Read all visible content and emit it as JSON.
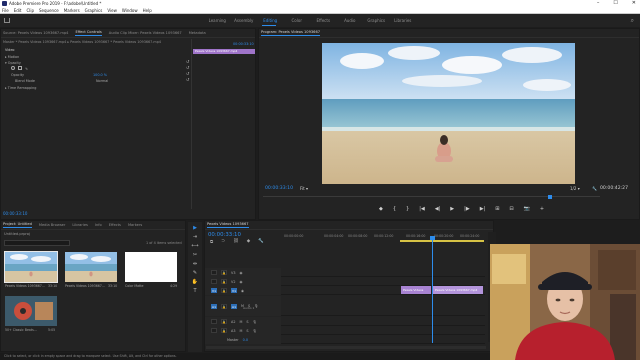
{
  "window": {
    "title": "Adobe Premiere Pro 2019 - F:\\adobe\\Untitled *",
    "minimize": "–",
    "maximize": "☐",
    "close": "✕"
  },
  "menu": [
    "File",
    "Edit",
    "Clip",
    "Sequence",
    "Markers",
    "Graphics",
    "View",
    "Window",
    "Help"
  ],
  "workspaces": {
    "tabs": [
      "Learning",
      "Assembly",
      "Editing",
      "Color",
      "Effects",
      "Audio",
      "Graphics",
      "Libraries"
    ],
    "active_index": 2
  },
  "source_panel": {
    "tabs": [
      "Source: Pexels Videos 1093667.mp4",
      "Effect Controls",
      "Audio Clip Mixer: Pexels Videos 1093667",
      "Metadata"
    ],
    "active_index": 1,
    "source_path": "Master * Pexels Videos 1093667.mp4   ▸   Pexels Videos 1093667 * Pexels Videos 1093667.mp4",
    "section_video": "Video",
    "rows": [
      "Motion",
      "Opacity",
      "Opacity",
      "Blend Mode",
      "Time Remapping"
    ],
    "opacity_value": "100.0 %",
    "blend_mode_value": "Normal",
    "mini_timecode": "00:00:33:10",
    "clip_label": "Pexels Videos 1093667.mp4",
    "timecode": "00:00:33:10"
  },
  "program_monitor": {
    "tab": "Program: Pexels Videos 1093667",
    "timecode_current": "00:00:33:10",
    "fit": "Fit",
    "scale": "1/2",
    "timecode_total": "00:00:42:27",
    "transport": [
      "◆",
      "{",
      "}",
      "|◀",
      "◀|",
      "▶",
      "|▶",
      "▶|",
      "⊞",
      "⊟",
      "📷",
      "+"
    ]
  },
  "project_panel": {
    "tabs": [
      "Project: Untitled",
      "Media Browser",
      "Libraries",
      "Info",
      "Effects",
      "Markers"
    ],
    "active_index": 0,
    "path": "Untitled.prproj",
    "item_count": "1 of 4 items selected",
    "items": [
      {
        "name": "Pexels Videos 1093667...",
        "duration": "33:10"
      },
      {
        "name": "Pexels Videos 1093667...",
        "duration": "33:10"
      },
      {
        "name": "Color Matte",
        "duration": "4:29"
      },
      {
        "name": "50+ Classic Beats...",
        "duration": "5:05"
      }
    ]
  },
  "timeline": {
    "tab": "Pexels Videos 1093667",
    "timecode": "00:00:33:10",
    "ruler": [
      "00:00:00:00",
      "00:00:04:00",
      "00:00:08:00",
      "00:00:12:00",
      "00:00:16:00",
      "00:00:20:00",
      "00:00:24:00"
    ],
    "tracks": [
      {
        "name": "V3",
        "label": "V3"
      },
      {
        "name": "V2",
        "label": "V2"
      },
      {
        "name": "V1",
        "label": "V1"
      },
      {
        "name": "A1",
        "label": "A1"
      },
      {
        "name": "A2",
        "label": "A2"
      },
      {
        "name": "A3",
        "label": "A3"
      }
    ],
    "clip_video_a": "Pexels Videos",
    "clip_video_b": "Pexels Videos 1093667.mp4",
    "audio_label": "Audio 1",
    "master_label": "Master",
    "master_value": "0.0"
  },
  "status_bar": "Click to select, or click in empty space and drag to marquee select. Use Shift, Alt, and Ctrl for other options."
}
